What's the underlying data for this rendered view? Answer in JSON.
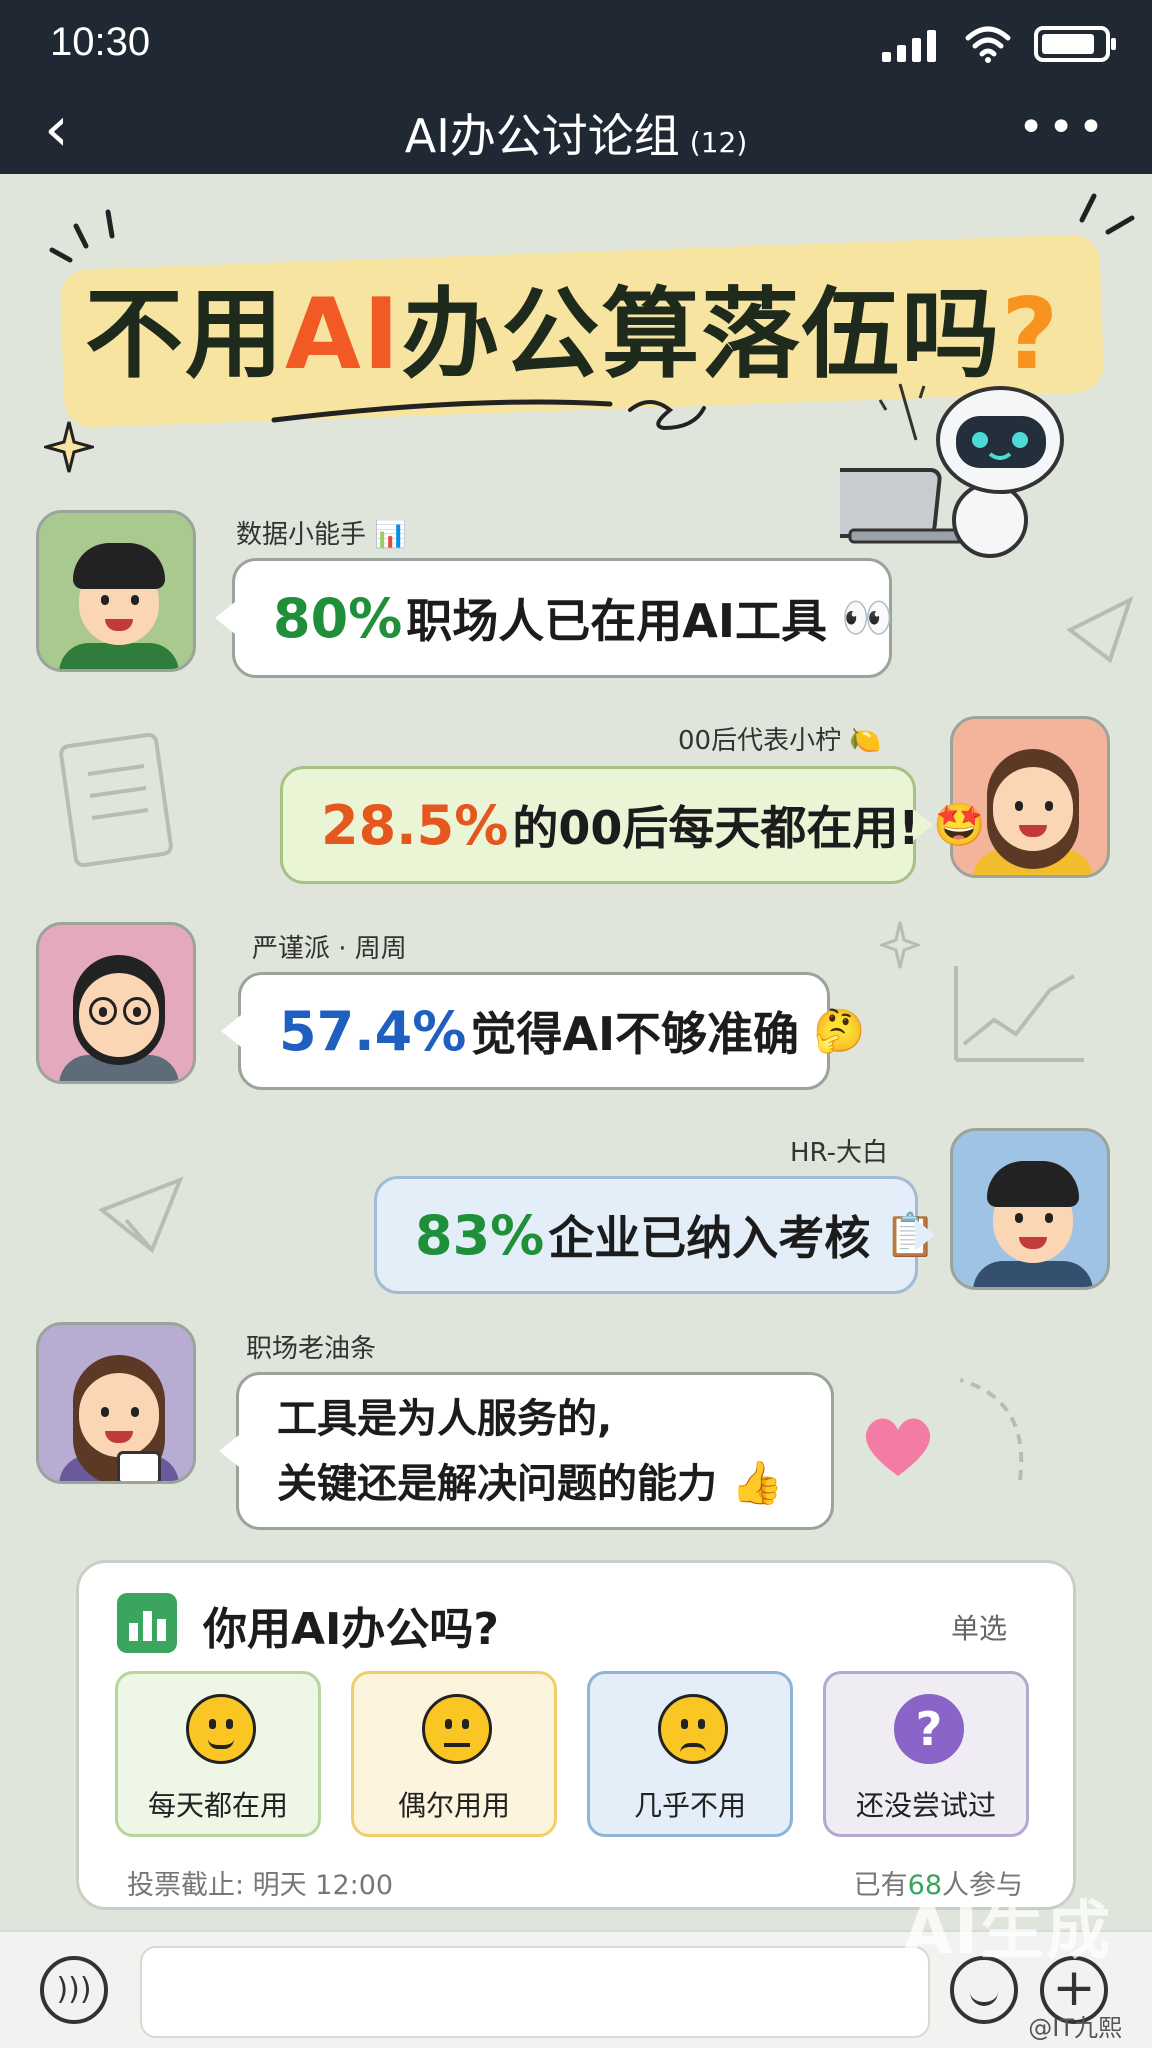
{
  "status_bar": {
    "time": "10:30"
  },
  "nav": {
    "back_icon": "‹",
    "title": "AI办公讨论组",
    "member_count": "(12)",
    "more_icon": "•••"
  },
  "headline": {
    "part1": "不用",
    "ai": "AI",
    "part2": "办公算落伍吗",
    "qmark": "?"
  },
  "messages": [
    {
      "sender": "数据小能手 📊",
      "pct": "80%",
      "pct_color": "#1f8f3a",
      "text": "职场人已在用AI工具",
      "emoji": "👀"
    },
    {
      "sender": "00后代表小柠 🍋",
      "pct": "28.5%",
      "pct_color": "#e4571f",
      "text": "的00后每天都在用!",
      "emoji": "🤩"
    },
    {
      "sender": "严谨派 · 周周",
      "pct": "57.4%",
      "pct_color": "#1e5fbf",
      "text": "觉得AI不够准确",
      "emoji": "🤔"
    },
    {
      "sender": "HR-大白",
      "pct": "83%",
      "pct_color": "#1f8f3a",
      "text": "企业已纳入考核",
      "emoji": "📋"
    },
    {
      "sender": "职场老油条",
      "line1": "工具是为人服务的,",
      "line2": "关键还是解决问题的能力",
      "emoji": "👍"
    }
  ],
  "poll": {
    "question": "你用AI办公吗?",
    "mode": "单选",
    "options": [
      {
        "label": "每天都在用",
        "bg": "#eef6e6",
        "border": "#b7d69e"
      },
      {
        "label": "偶尔用用",
        "bg": "#fdf4dd",
        "border": "#f0cf6b"
      },
      {
        "label": "几乎不用",
        "bg": "#e3eef8",
        "border": "#8fb4d8"
      },
      {
        "label": "还没尝试过",
        "bg": "#efecf4",
        "border": "#b4a8cf"
      }
    ],
    "deadline": "投票截止: 明天 12:00",
    "participants_prefix": "已有",
    "participants_count": "68",
    "participants_suffix": "人参与"
  },
  "watermark": "AI生成",
  "handle": "@IT九熙"
}
